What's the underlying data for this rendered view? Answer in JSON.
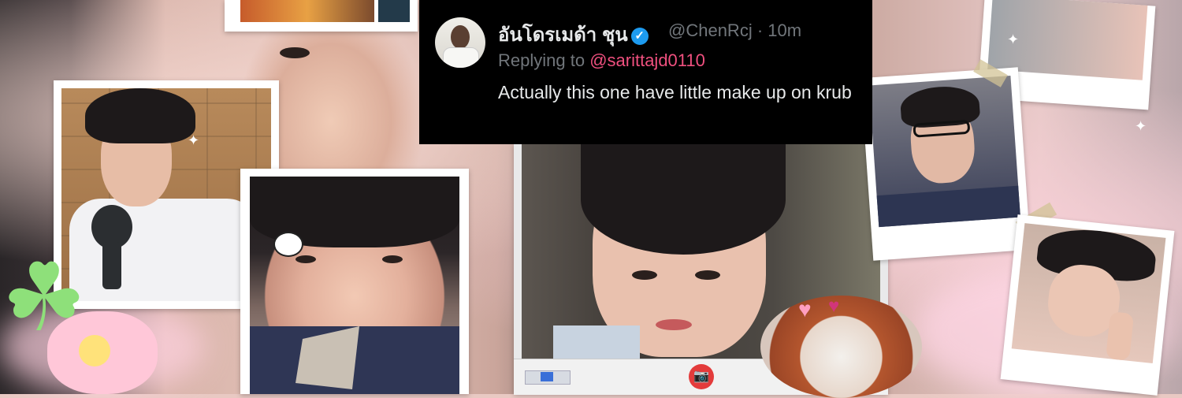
{
  "tweet": {
    "display_name": "อันโดรเมด้า ชุน",
    "verified_icon": "✓",
    "handle_time": "@ChenRcj · 10m",
    "replying_prefix": "Replying to ",
    "replying_handle": "@sarittajd0110",
    "text": "Actually this one have little make up on krub"
  },
  "colors": {
    "tweet_bg": "#000000",
    "link": "#f0507f",
    "verified": "#1d9bf0",
    "muted": "#71767b"
  },
  "icons": {
    "camera": "📷",
    "heart": "♥",
    "clover": "☘",
    "sparkle": "✦"
  }
}
